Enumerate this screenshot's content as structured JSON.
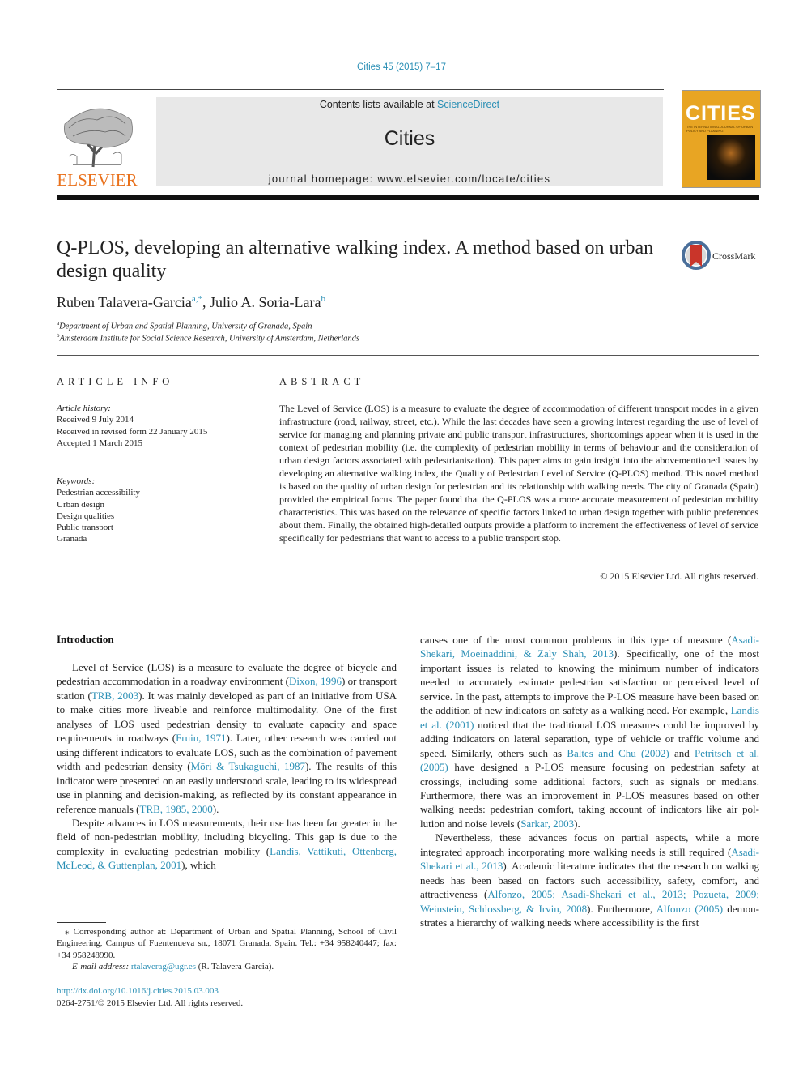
{
  "journal_ref": "Cities 45 (2015) 7–17",
  "banner": {
    "publisher": "ELSEVIER",
    "contents_prefix": "Contents lists available at ",
    "contents_link": "ScienceDirect",
    "journal_name": "Cities",
    "homepage": "journal homepage: www.elsevier.com/locate/cities",
    "cover_title": "CITIES",
    "cover_subtitle": "THE INTERNATIONAL JOURNAL OF URBAN POLICY AND PLANNING"
  },
  "colors": {
    "link": "#2a8fb5",
    "elsevier_orange": "#e9711c",
    "banner_bg": "#e8e8e8",
    "cover": "#e8a523"
  },
  "article": {
    "title": "Q-PLOS, developing an alternative walking index. A method based on urban design quality",
    "crossmark_label": "CrossMark",
    "authors": [
      {
        "name": "Ruben Talavera-Garcia",
        "sup": "a,*"
      },
      {
        "name": "Julio A. Soria-Lara",
        "sup": "b"
      }
    ],
    "affiliations": [
      {
        "sup": "a",
        "text": "Department of Urban and Spatial Planning, University of Granada, Spain"
      },
      {
        "sup": "b",
        "text": "Amsterdam Institute for Social Science Research, University of Amsterdam, Netherlands"
      }
    ]
  },
  "article_info": {
    "heading": "ARTICLE INFO",
    "history_label": "Article history:",
    "history": [
      "Received 9 July 2014",
      "Received in revised form 22 January 2015",
      "Accepted 1 March 2015"
    ],
    "keywords_label": "Keywords:",
    "keywords": [
      "Pedestrian accessibility",
      "Urban design",
      "Design qualities",
      "Public transport",
      "Granada"
    ]
  },
  "abstract": {
    "heading": "ABSTRACT",
    "text": "The Level of Service (LOS) is a measure to evaluate the degree of accommodation of different transport modes in a given infrastructure (road, railway, street, etc.). While the last decades have seen a growing interest regarding the use of level of service for managing and planning private and public transport infrastructures, shortcomings appear when it is used in the context of pedestrian mobility (i.e. the complexity of pedestrian mobility in terms of behaviour and the consideration of urban design factors associated with pedestrianisation). This paper aims to gain insight into the abovementioned issues by developing an alternative walking index, the Quality of Pedestrian Level of Service (Q-PLOS) method. This novel method is based on the quality of urban design for pedestrian and its relationship with walking needs. The city of Granada (Spain) provided the empirical focus. The paper found that the Q-PLOS was a more accurate measurement of pedestrian mobility characteristics. This was based on the relevance of specific factors linked to urban design together with public preferences about them. Finally, the obtained high-detailed outputs provide a platform to increment the effectiveness of level of service specifically for pedestrians that want to access to a public transport stop.",
    "copyright": "© 2015 Elsevier Ltd. All rights reserved."
  },
  "body": {
    "section_heading": "Introduction",
    "left_p1": [
      {
        "t": "Level of Service (LOS) is a measure to evaluate the degree of bicycle and pedestrian accommodation in a roadway environment ("
      },
      {
        "l": "Dixon, 1996"
      },
      {
        "t": ") or transport station ("
      },
      {
        "l": "TRB, 2003"
      },
      {
        "t": "). It was mainly devel­oped as part of an initiative from USA to make cities more liveable and reinforce multimodality. One of the first analyses of LOS used pedestrian density to evaluate capacity and space requirements in roadways ("
      },
      {
        "l": "Fruin, 1971"
      },
      {
        "t": "). Later, other research was carried out using different indicators to evaluate LOS, such as the combination of pavement width and pedestrian density ("
      },
      {
        "l": "Mōri & Tsukaguchi, 1987"
      },
      {
        "t": "). The results of this indicator were presented on an easily understood scale, leading to its widespread use in planning and decision-making, as reflected by its constant appearance in refer­ence manuals ("
      },
      {
        "l": "TRB, 1985, 2000"
      },
      {
        "t": ")."
      }
    ],
    "left_p2": [
      {
        "t": "Despite advances in LOS measurements, their use has been far greater in the field of non-pedestrian mobility, including bicycling. This gap is due to the complexity in evaluating pedestrian mobility ("
      },
      {
        "l": "Landis, Vattikuti, Ottenberg, McLeod, & Guttenplan, 2001"
      },
      {
        "t": "), which"
      }
    ],
    "right_p1": [
      {
        "t": "causes one of the most common problems in this type of measure ("
      },
      {
        "l": "Asadi-Shekari, Moeinaddini, & Zaly Shah, 2013"
      },
      {
        "t": "). Specifically, one of the most important issues is related to knowing the minimum number of indicators needed to accurately estimate pedestrian satisfaction or perceived level of service. In the past, attempts to improve the P-LOS measure have been based on the addition of new indicators on safety as a walking need. For example, "
      },
      {
        "l": "Landis et al. (2001)"
      },
      {
        "t": " noticed that the traditional LOS measures could be improved by adding indicators on lateral separation, type of vehi­cle or traffic volume and speed. Similarly, others such as "
      },
      {
        "l": "Baltes and Chu (2002)"
      },
      {
        "t": " and "
      },
      {
        "l": "Petritsch et al. (2005)"
      },
      {
        "t": " have designed a P-LOS mea­sure focusing on pedestrian safety at crossings, including some additional factors, such as signals or medians. Furthermore, there was an improvement in P-LOS measures based on other walking needs: pedestrian comfort, taking account of indicators like air pol­lution and noise levels ("
      },
      {
        "l": "Sarkar, 2003"
      },
      {
        "t": ")."
      }
    ],
    "right_p2": [
      {
        "t": "Nevertheless, these advances focus on partial aspects, while a more integrated approach incorporating more walking needs is still required ("
      },
      {
        "l": "Asadi-Shekari et al., 2013"
      },
      {
        "t": "). Academic literature indi­cates that the research on walking needs has been based on factors such accessibility, safety, comfort, and attractiveness ("
      },
      {
        "l": "Alfonzo, 2005; Asadi-Shekari et al., 2013; Pozueta, 2009; Weinstein, Schlossberg, & Irvin, 2008"
      },
      {
        "t": "). Furthermore, "
      },
      {
        "l": "Alfonzo (2005)"
      },
      {
        "t": " demon­strates a hierarchy of walking needs where accessibility is the first"
      }
    ]
  },
  "footnote": {
    "marker": "⁎",
    "corresponding": "Corresponding author at: Department of Urban and Spatial Planning, School of Civil Engineering, Campus of Fuentenueva sn., 18071 Granada, Spain. Tel.: +34 958240447; fax: +34 958248990.",
    "email_label": "E-mail address: ",
    "email": "rtalaverag@ugr.es",
    "email_suffix": " (R. Talavera-Garcia)."
  },
  "doi": {
    "url": "http://dx.doi.org/10.1016/j.cities.2015.03.003",
    "issn_line": "0264-2751/© 2015 Elsevier Ltd. All rights reserved."
  }
}
